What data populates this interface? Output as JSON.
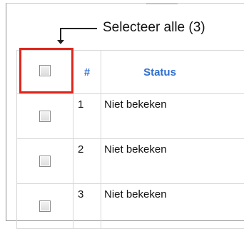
{
  "annotation": {
    "select_all_label": "Selecteer alle (3)"
  },
  "table": {
    "headers": {
      "number": "#",
      "status": "Status"
    },
    "rows": [
      {
        "number": "1",
        "status": "Niet bekeken"
      },
      {
        "number": "2",
        "status": "Niet bekeken"
      },
      {
        "number": "3",
        "status": "Niet bekeken"
      }
    ]
  },
  "colors": {
    "highlight": "#e0251b",
    "header_text": "#2f6fd0"
  }
}
